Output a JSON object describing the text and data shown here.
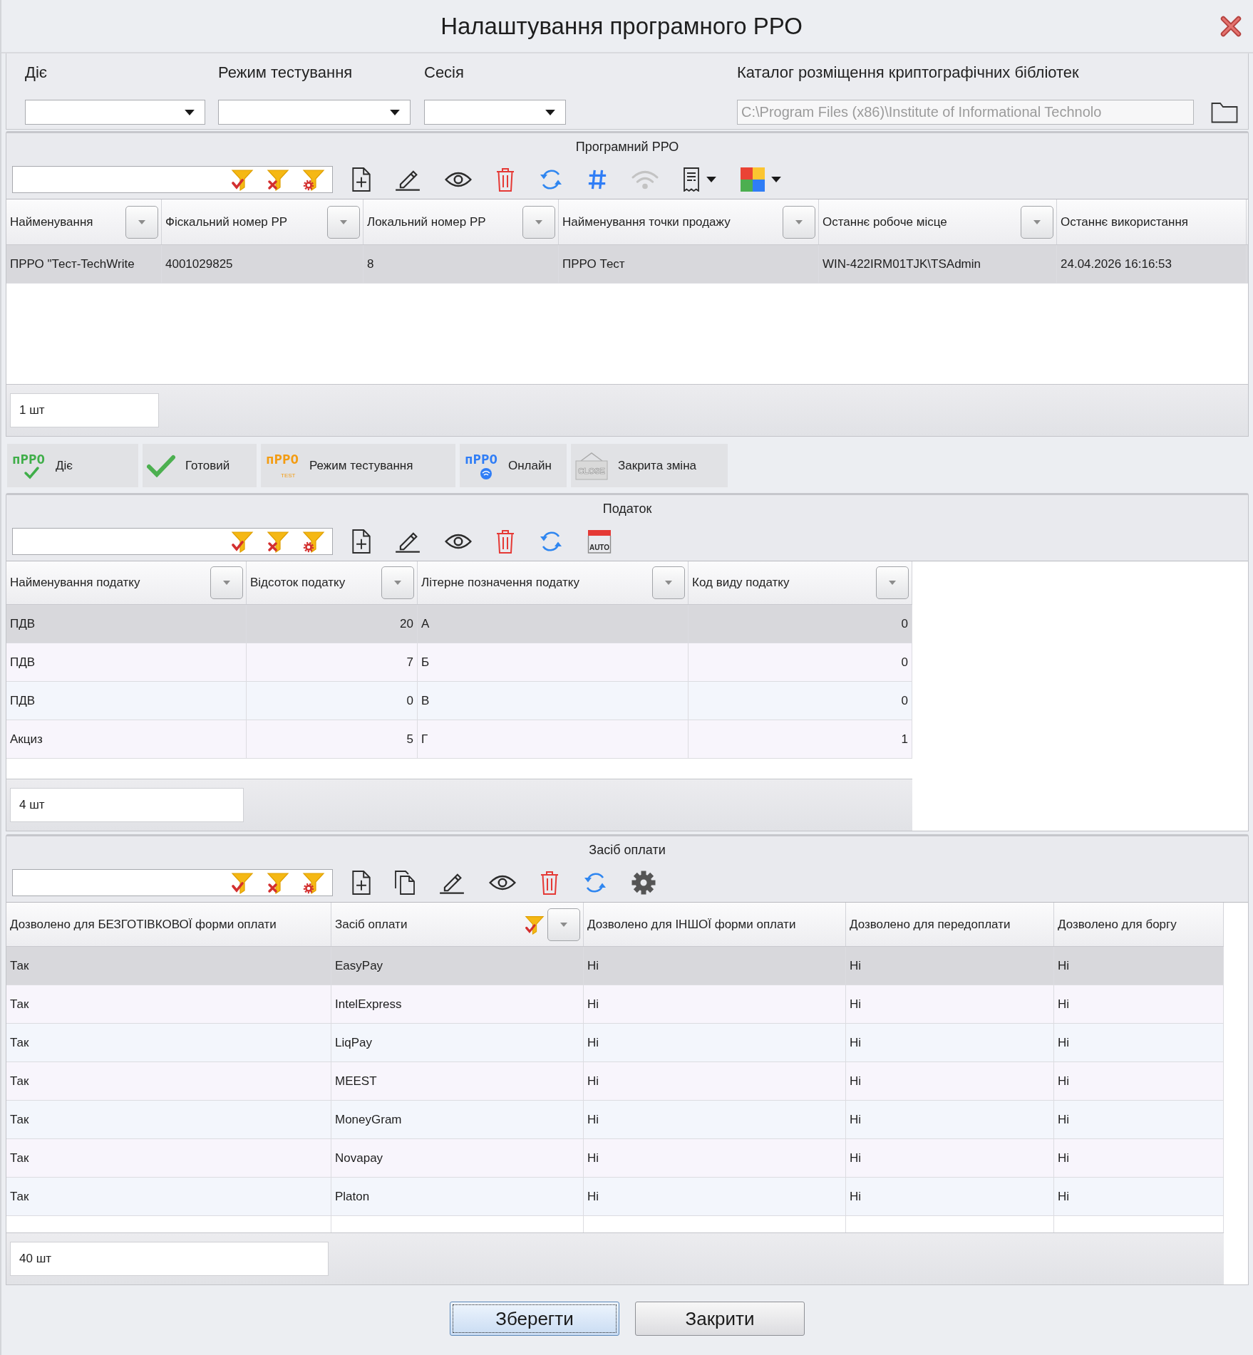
{
  "window": {
    "title": "Налаштування програмного РРО"
  },
  "filters": [
    {
      "label": "Діє"
    },
    {
      "label": "Режим тестування"
    },
    {
      "label": "Сесія"
    }
  ],
  "library_path": {
    "label": "Каталог розміщення криптографічних бібліотек",
    "value": "C:\\Program Files (x86)\\Institute of Informational Technolo",
    "disabled": true
  },
  "prro": {
    "title": "Програмний РРО",
    "tools": [
      {
        "kind": "add",
        "disabled": false,
        "dropdown": false
      },
      {
        "kind": "edit",
        "disabled": false,
        "dropdown": false
      },
      {
        "kind": "view",
        "disabled": false,
        "dropdown": false
      },
      {
        "kind": "delete",
        "disabled": false,
        "dropdown": false
      },
      {
        "kind": "refresh",
        "disabled": false,
        "dropdown": false
      },
      {
        "kind": "number",
        "disabled": false,
        "dropdown": false
      },
      {
        "kind": "wifi",
        "disabled": true,
        "dropdown": false
      },
      {
        "kind": "receipt",
        "disabled": false,
        "dropdown": true
      },
      {
        "kind": "colors",
        "disabled": false,
        "dropdown": true
      }
    ],
    "columns": [
      {
        "label": "Найменування",
        "dropdown": true,
        "filtered": false
      },
      {
        "label": "Фіскальний номер РР",
        "dropdown": true,
        "filtered": false
      },
      {
        "label": "Локальний номер РР",
        "dropdown": true,
        "filtered": false
      },
      {
        "label": "Найменування точки продажу",
        "dropdown": true,
        "filtered": false
      },
      {
        "label": "Останнє робоче місце",
        "dropdown": true,
        "filtered": false
      },
      {
        "label": "Останнє використання",
        "dropdown": false,
        "filtered": false
      }
    ],
    "rows": [
      {
        "cells": [
          "ПРРО \"Тест-TechWrite",
          "4001029825",
          "8",
          "ПРРО Тест",
          "WIN-422IRM01TJK\\TSAdmin",
          "24.04.2026 16:16:53"
        ],
        "selected": true
      }
    ],
    "count": "1 шт"
  },
  "legend": [
    {
      "kind": "active",
      "icon_text": "пРРО",
      "label": "Діє"
    },
    {
      "kind": "ready",
      "label": "Готовий"
    },
    {
      "kind": "test",
      "icon_text": "пРРО",
      "icon_subtext": "TEST",
      "label": "Режим тестування"
    },
    {
      "kind": "online",
      "icon_text": "пРРО",
      "label": "Онлайн"
    },
    {
      "kind": "closed",
      "icon_text": "CLOSE",
      "label": "Закрита зміна"
    }
  ],
  "tax": {
    "title": "Податок",
    "tools": [
      {
        "kind": "add",
        "disabled": false,
        "dropdown": false
      },
      {
        "kind": "edit",
        "disabled": false,
        "dropdown": false
      },
      {
        "kind": "view",
        "disabled": false,
        "dropdown": false
      },
      {
        "kind": "delete",
        "disabled": false,
        "dropdown": false
      },
      {
        "kind": "refresh",
        "disabled": false,
        "dropdown": false
      },
      {
        "kind": "auto",
        "icon_text": "AUTO",
        "disabled": false,
        "dropdown": false
      }
    ],
    "columns": [
      {
        "label": "Найменування податку",
        "kind": "text",
        "dropdown": true,
        "filtered": false
      },
      {
        "label": "Відсоток податку",
        "kind": "number",
        "dropdown": true,
        "filtered": false
      },
      {
        "label": "Літерне позначення податку",
        "kind": "text",
        "dropdown": true,
        "filtered": false
      },
      {
        "label": "Код виду податку",
        "kind": "number",
        "dropdown": true,
        "filtered": false
      }
    ],
    "rows": [
      {
        "cells": [
          "ПДВ",
          "20",
          "А",
          "0"
        ],
        "selected": true
      },
      {
        "cells": [
          "ПДВ",
          "7",
          "Б",
          "0"
        ],
        "selected": false
      },
      {
        "cells": [
          "ПДВ",
          "0",
          "В",
          "0"
        ],
        "selected": false
      },
      {
        "cells": [
          "Акциз",
          "5",
          "Г",
          "1"
        ],
        "selected": false
      }
    ],
    "count": "4 шт"
  },
  "payment": {
    "title": "Засіб оплати",
    "tools": [
      {
        "kind": "add",
        "disabled": false,
        "dropdown": false
      },
      {
        "kind": "copy",
        "disabled": false,
        "dropdown": false
      },
      {
        "kind": "edit",
        "disabled": false,
        "dropdown": false
      },
      {
        "kind": "view",
        "disabled": false,
        "dropdown": false
      },
      {
        "kind": "delete",
        "disabled": false,
        "dropdown": false
      },
      {
        "kind": "refresh",
        "disabled": false,
        "dropdown": false
      },
      {
        "kind": "settings",
        "disabled": false,
        "dropdown": false
      }
    ],
    "columns": [
      {
        "label": "Дозволено для БЕЗГОТІВКОВОЇ форми оплати",
        "dropdown": false,
        "filtered": false
      },
      {
        "label": "Засіб оплати",
        "dropdown": true,
        "filtered": true
      },
      {
        "label": "Дозволено для ІНШОЇ форми оплати",
        "dropdown": false,
        "filtered": false
      },
      {
        "label": "Дозволено для передоплати",
        "dropdown": false,
        "filtered": false
      },
      {
        "label": "Дозволено для боргу",
        "dropdown": false,
        "filtered": false
      }
    ],
    "rows": [
      {
        "cells": [
          "Так",
          "EasyPay",
          "Ні",
          "Ні",
          "Ні"
        ],
        "selected": true
      },
      {
        "cells": [
          "Так",
          "IntelExpress",
          "Ні",
          "Ні",
          "Ні"
        ],
        "selected": false
      },
      {
        "cells": [
          "Так",
          "LiqPay",
          "Ні",
          "Ні",
          "Ні"
        ],
        "selected": false
      },
      {
        "cells": [
          "Так",
          "MEEST",
          "Ні",
          "Ні",
          "Ні"
        ],
        "selected": false
      },
      {
        "cells": [
          "Так",
          "MoneyGram",
          "Ні",
          "Ні",
          "Ні"
        ],
        "selected": false
      },
      {
        "cells": [
          "Так",
          "Novapay",
          "Ні",
          "Ні",
          "Ні"
        ],
        "selected": false
      },
      {
        "cells": [
          "Так",
          "Platon",
          "Ні",
          "Ні",
          "Ні"
        ],
        "selected": false
      }
    ],
    "count": "40 шт"
  },
  "buttons": [
    {
      "label": "Зберегти",
      "focused": true
    },
    {
      "label": "Закрити",
      "focused": false
    }
  ]
}
